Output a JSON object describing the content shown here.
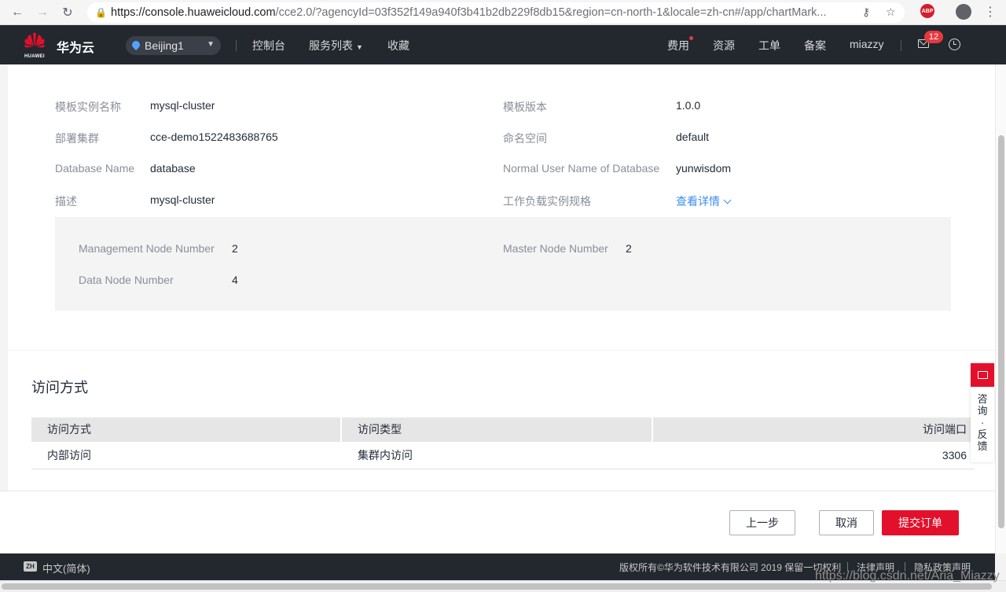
{
  "browser": {
    "url_host": "https://console.huaweicloud.com",
    "url_rest": "/cce2.0/?agencyId=03f352f149a940f3b41b2db229f8db15&region=cn-north-1&locale=zh-cn#/app/chartMark...",
    "extension_label": "ABP"
  },
  "header": {
    "logo_word": "HUAWEI",
    "brand": "华为云",
    "region": "Beijing1",
    "nav": {
      "console": "控制台",
      "services": "服务列表",
      "favorites": "收藏"
    },
    "right": {
      "fees": "费用",
      "resources": "资源",
      "tickets": "工单",
      "filing": "备案",
      "user": "miazzy",
      "mail_count": "12"
    }
  },
  "details": {
    "instance_name_label": "模板实例名称",
    "instance_name": "mysql-cluster",
    "template_version_label": "模板版本",
    "template_version": "1.0.0",
    "cluster_label": "部署集群",
    "cluster": "cce-demo1522483688765",
    "namespace_label": "命名空间",
    "namespace": "default",
    "db_name_label": "Database Name",
    "db_name": "database",
    "db_user_label": "Normal User Name of Database",
    "db_user": "yunwisdom",
    "desc_label": "描述",
    "desc": "mysql-cluster",
    "workload_spec_label": "工作负载实例规格",
    "view_details": "查看详情",
    "spec": {
      "mgmt_label": "Management Node Number",
      "mgmt": "2",
      "master_label": "Master Node Number",
      "master": "2",
      "data_label": "Data Node Number",
      "data": "4"
    }
  },
  "access": {
    "title": "访问方式",
    "columns": [
      "访问方式",
      "访问类型",
      "访问端口"
    ],
    "rows": [
      [
        "内部访问",
        "集群内访问",
        "3306"
      ]
    ]
  },
  "actions": {
    "prev": "上一步",
    "cancel": "取消",
    "submit": "提交订单"
  },
  "feedback": {
    "label_1": "咨",
    "label_2": "询",
    "label_3": "·",
    "label_4": "反",
    "label_5": "馈"
  },
  "footer": {
    "lang_icon": "ZH",
    "lang": "中文(简体)",
    "copyright": "版权所有©华为软件技术有限公司 2019 保留一切权利",
    "legal": "法律声明",
    "privacy": "隐私政策声明"
  },
  "watermark": "https://blog.csdn.net/Aria_Miazzy",
  "colors": {
    "accent_red": "#e3102c",
    "header_bg": "#23272e",
    "link_blue": "#3b8ef0"
  }
}
